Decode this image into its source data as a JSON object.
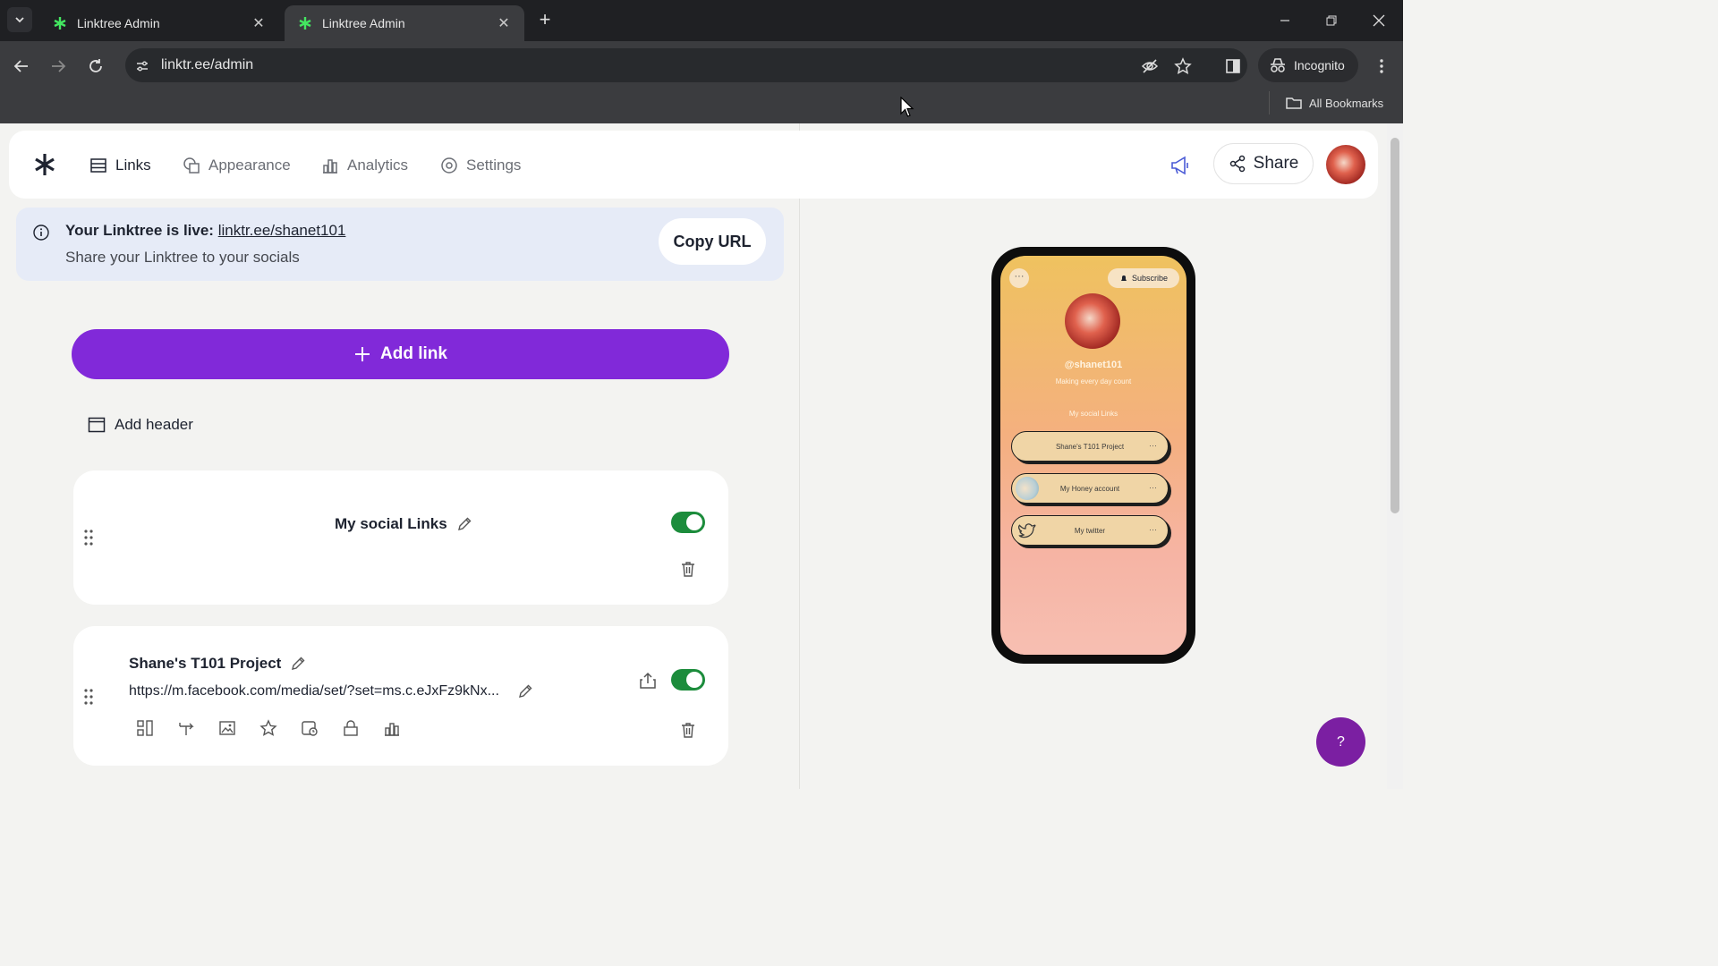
{
  "browser": {
    "tabs": [
      {
        "title": "Linktree Admin",
        "active": false
      },
      {
        "title": "Linktree Admin",
        "active": true
      }
    ],
    "url": "linktr.ee/admin",
    "incognito_label": "Incognito",
    "bookmarks_label": "All Bookmarks"
  },
  "nav": {
    "items": [
      {
        "label": "Links",
        "icon": "list-icon",
        "active": true
      },
      {
        "label": "Appearance",
        "icon": "shapes-icon",
        "active": false
      },
      {
        "label": "Analytics",
        "icon": "bar-chart-icon",
        "active": false
      },
      {
        "label": "Settings",
        "icon": "gear-icon",
        "active": false
      }
    ],
    "share_label": "Share"
  },
  "banner": {
    "live_prefix": "Your Linktree is live:",
    "live_url": "linktr.ee/shanet101",
    "subtitle": "Share your Linktree to your socials",
    "copy_label": "Copy URL"
  },
  "actions": {
    "add_link_label": "Add link",
    "add_header_label": "Add header"
  },
  "cards": {
    "header_card": {
      "title": "My social Links",
      "enabled": true
    },
    "link_card": {
      "title": "Shane's T101 Project",
      "url": "https://m.facebook.com/media/set/?set=ms.c.eJxFz9kNx...",
      "enabled": true
    }
  },
  "preview": {
    "more_label": "···",
    "subscribe_label": "Subscribe",
    "handle": "@shanet101",
    "bio": "Making every day count",
    "section": "My social Links",
    "links": [
      {
        "label": "Shane's T101 Project"
      },
      {
        "label": "My Honey account"
      },
      {
        "label": "My twitter"
      }
    ]
  },
  "help_label": "?",
  "colors": {
    "accent_purple": "#8129d9",
    "toggle_green": "#1c8c3c",
    "banner_bg": "#e6ebf7"
  }
}
